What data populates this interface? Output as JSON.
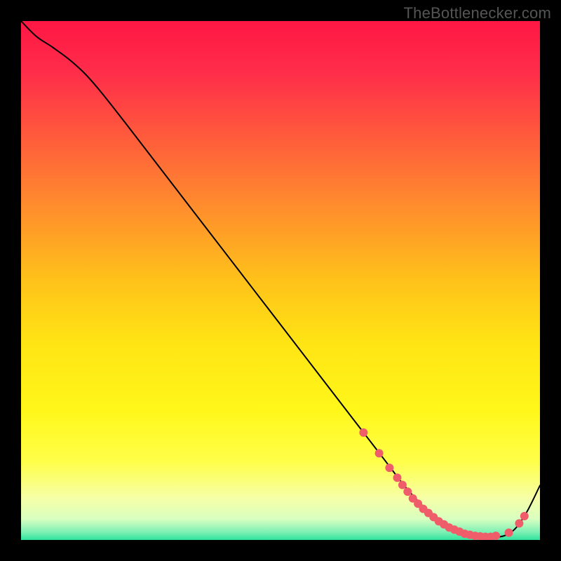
{
  "watermark": "TheBottlenecker.com",
  "chart_data": {
    "type": "line",
    "title": "",
    "xlabel": "",
    "ylabel": "",
    "xlim": [
      0,
      100
    ],
    "ylim": [
      0,
      100
    ],
    "grid": false,
    "legend": false,
    "background_gradient_stops": [
      {
        "offset": 0.0,
        "color": "#ff1744"
      },
      {
        "offset": 0.1,
        "color": "#ff2d4a"
      },
      {
        "offset": 0.22,
        "color": "#ff5a3c"
      },
      {
        "offset": 0.35,
        "color": "#ff8a2e"
      },
      {
        "offset": 0.5,
        "color": "#ffc21a"
      },
      {
        "offset": 0.62,
        "color": "#ffe414"
      },
      {
        "offset": 0.75,
        "color": "#fff71a"
      },
      {
        "offset": 0.85,
        "color": "#ffff4a"
      },
      {
        "offset": 0.92,
        "color": "#f6ffa8"
      },
      {
        "offset": 0.96,
        "color": "#d8ffc0"
      },
      {
        "offset": 0.985,
        "color": "#7cf0b4"
      },
      {
        "offset": 1.0,
        "color": "#2fe29c"
      }
    ],
    "curve": {
      "x": [
        0,
        3,
        6,
        10,
        14,
        20,
        30,
        40,
        50,
        60,
        66,
        70,
        74,
        78,
        82,
        86,
        90,
        94,
        97,
        100
      ],
      "y": [
        100,
        97,
        95,
        92,
        88,
        80.5,
        67.5,
        54.5,
        41.5,
        28.5,
        20.7,
        15.5,
        10.3,
        6.0,
        3.0,
        1.2,
        0.5,
        1.2,
        4.6,
        10.5
      ],
      "stroke": "#000000",
      "stroke_width": 2
    },
    "marker_series": {
      "name": "markers",
      "points": [
        {
          "x": 66,
          "y": 20.7
        },
        {
          "x": 69,
          "y": 16.7
        },
        {
          "x": 71,
          "y": 13.9
        },
        {
          "x": 72.5,
          "y": 12.0
        },
        {
          "x": 73.5,
          "y": 10.6
        },
        {
          "x": 74.5,
          "y": 9.3
        },
        {
          "x": 75.5,
          "y": 8.0
        },
        {
          "x": 76.5,
          "y": 7.0
        },
        {
          "x": 77.5,
          "y": 6.0
        },
        {
          "x": 78.5,
          "y": 5.2
        },
        {
          "x": 79.5,
          "y": 4.4
        },
        {
          "x": 80.5,
          "y": 3.6
        },
        {
          "x": 81.5,
          "y": 3.0
        },
        {
          "x": 82.5,
          "y": 2.4
        },
        {
          "x": 83.5,
          "y": 2.0
        },
        {
          "x": 84.5,
          "y": 1.6
        },
        {
          "x": 85.5,
          "y": 1.2
        },
        {
          "x": 86.5,
          "y": 1.0
        },
        {
          "x": 87.5,
          "y": 0.8
        },
        {
          "x": 88.5,
          "y": 0.7
        },
        {
          "x": 89.5,
          "y": 0.6
        },
        {
          "x": 90.5,
          "y": 0.6
        },
        {
          "x": 91.5,
          "y": 0.8
        },
        {
          "x": 94.0,
          "y": 1.4
        },
        {
          "x": 96.0,
          "y": 3.2
        },
        {
          "x": 97.0,
          "y": 4.6
        }
      ],
      "color": "#ef5d6a",
      "radius": 6
    }
  }
}
